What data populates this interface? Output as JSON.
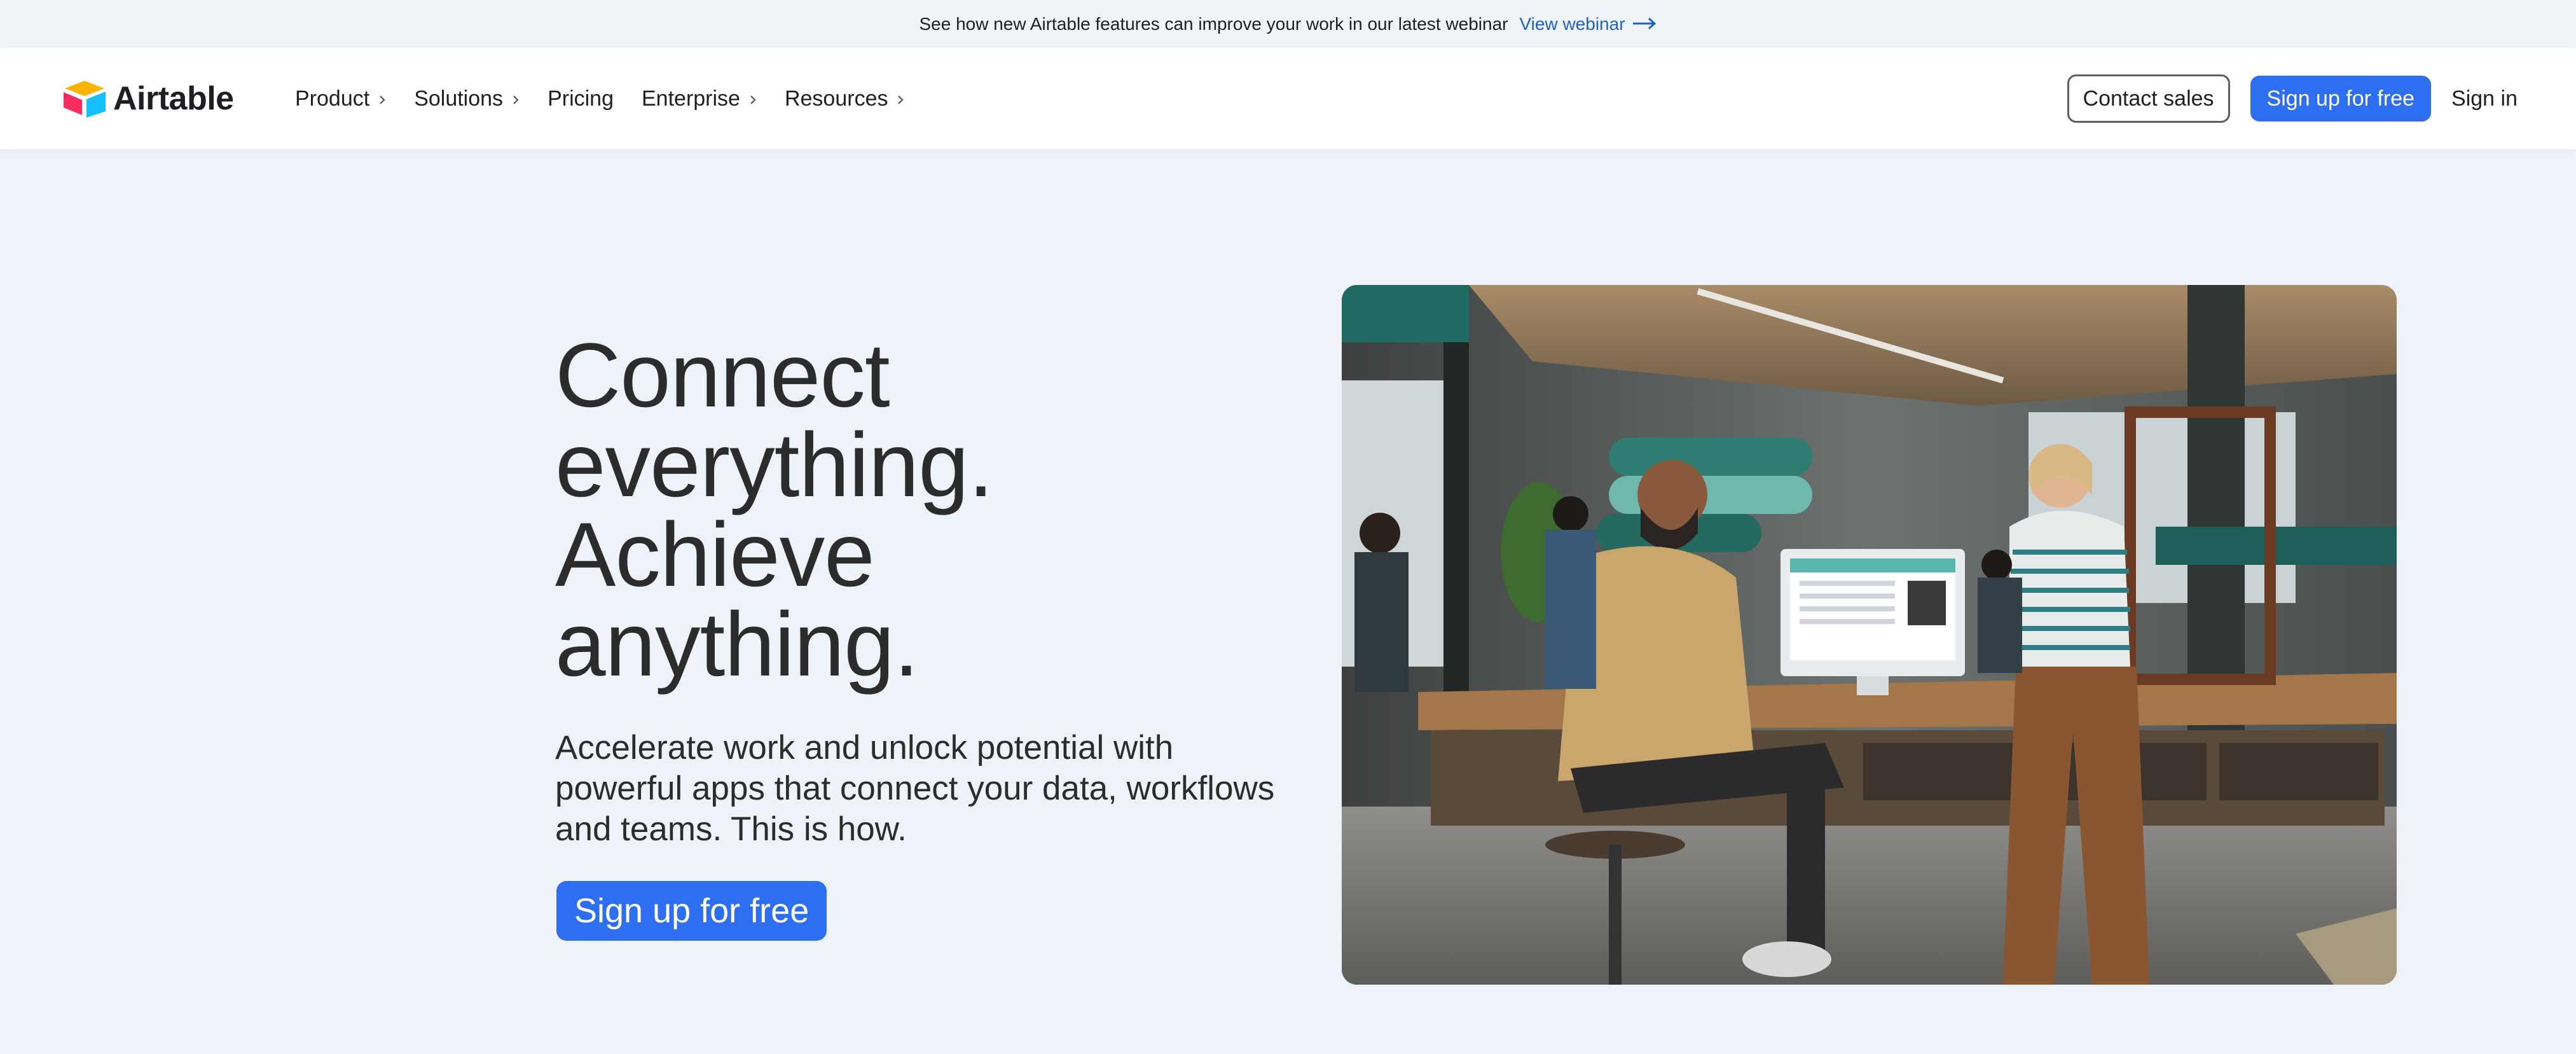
{
  "announcement": {
    "message": "See how new Airtable features can improve your work in our latest webinar",
    "link_label": "View webinar"
  },
  "nav": {
    "logo_text": "Airtable",
    "items": [
      {
        "label": "Product",
        "has_submenu": true
      },
      {
        "label": "Solutions",
        "has_submenu": true
      },
      {
        "label": "Pricing",
        "has_submenu": false
      },
      {
        "label": "Enterprise",
        "has_submenu": true
      },
      {
        "label": "Resources",
        "has_submenu": true
      }
    ],
    "contact_sales": "Contact sales",
    "sign_up": "Sign up for free",
    "sign_in": "Sign in"
  },
  "hero": {
    "headline_lines": [
      "Connect",
      "everything.",
      "Achieve",
      "anything."
    ],
    "subheadline": "Accelerate work and unlock potential with powerful apps that connect your data, workflows and teams. This is how.",
    "cta_label": "Sign up for free"
  },
  "colors": {
    "accent": "#2d6ff0",
    "link": "#1b61c9",
    "hero_background": "#edf3f8",
    "text": "#2c2c2c"
  },
  "icons": {
    "logo": "airtable-logo-icon",
    "submenu": "chevron-right-icon",
    "link_arrow": "arrow-right-icon"
  }
}
